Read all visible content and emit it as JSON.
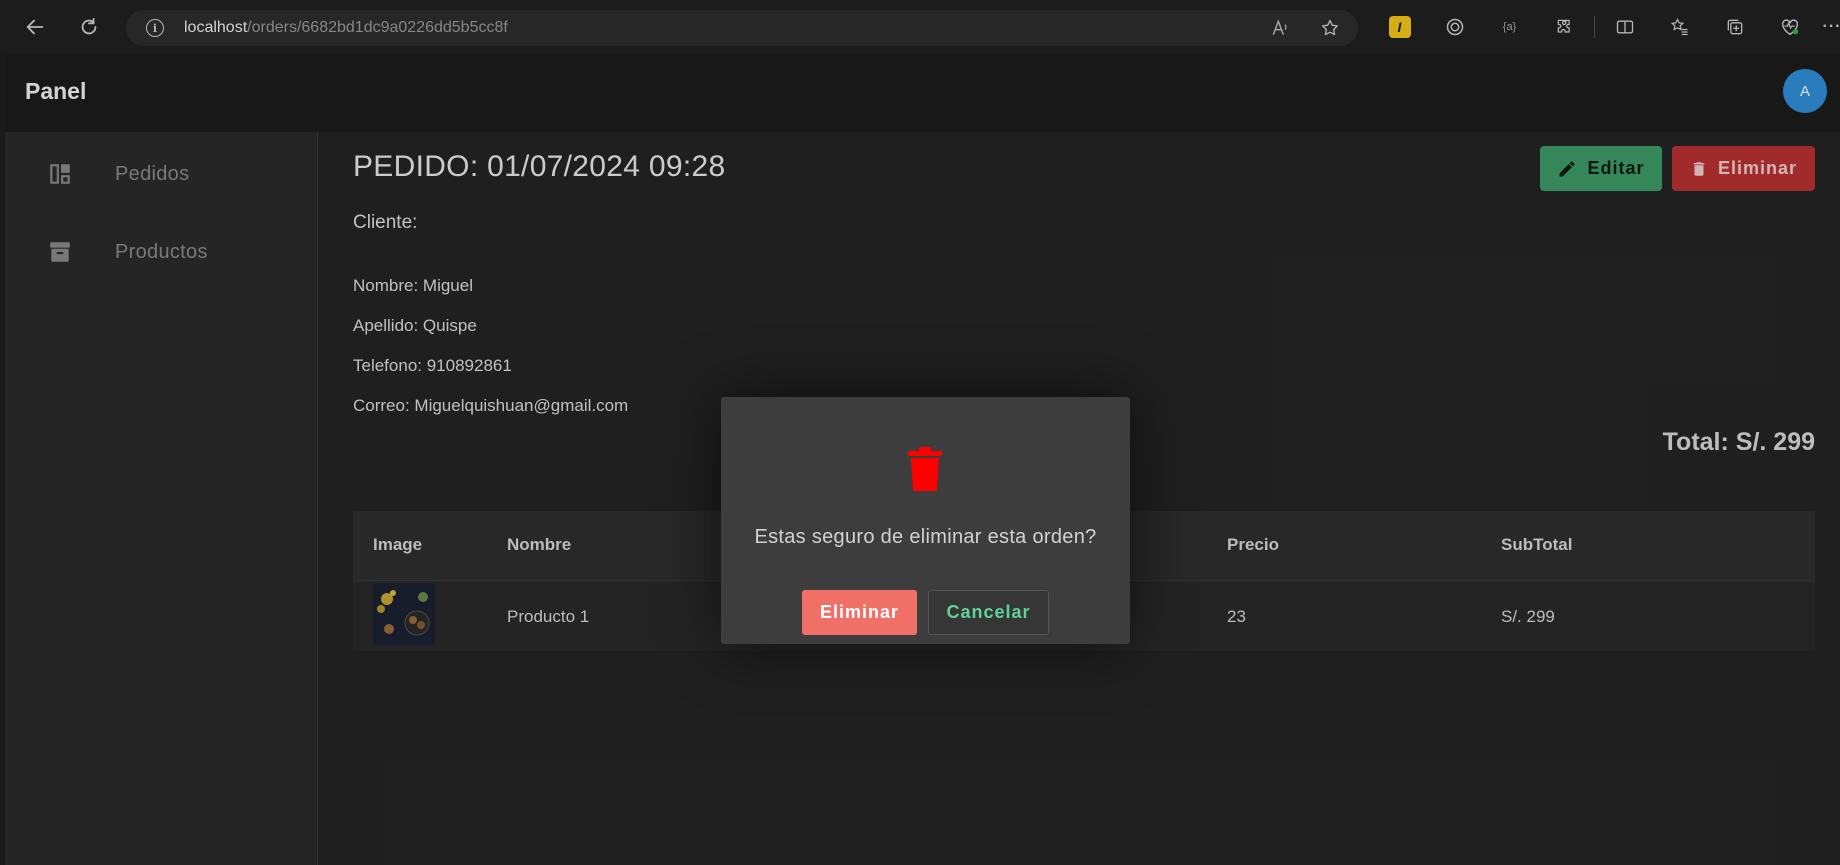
{
  "browser": {
    "url_host": "localhost",
    "url_path": "/orders/6682bd1dc9a0226dd5b5cc8f"
  },
  "app": {
    "brand": "Panel",
    "avatar_initial": "A"
  },
  "sidebar": {
    "items": [
      {
        "label": "Pedidos",
        "icon": "dashboard-icon"
      },
      {
        "label": "Productos",
        "icon": "archive-icon"
      }
    ]
  },
  "order": {
    "title": "PEDIDO: 01/07/2024 09:28",
    "edit_label": "Editar",
    "delete_label": "Eliminar",
    "client_heading": "Cliente:",
    "client": {
      "nombre": "Nombre: Miguel",
      "apellido": "Apellido: Quispe",
      "telefono": "Telefono: 910892861",
      "correo": "Correo: Miguelquishuan@gmail.com"
    },
    "total": "Total: S/. 299"
  },
  "table": {
    "headers": [
      "Image",
      "Nombre",
      "Precio",
      "SubTotal"
    ],
    "rows": [
      {
        "nombre": "Producto 1",
        "precio": "23",
        "subtotal": "S/. 299"
      }
    ]
  },
  "modal": {
    "message": "Estas seguro de eliminar esta orden?",
    "confirm_label": "Eliminar",
    "cancel_label": "Cancelar"
  },
  "colors": {
    "edit": "#3d9a66",
    "delete": "#b83030",
    "modal_confirm": "#f07068",
    "modal_cancel_text": "#5fd39a",
    "trash_icon": "#ff0000",
    "avatar": "#2f8fd8"
  }
}
